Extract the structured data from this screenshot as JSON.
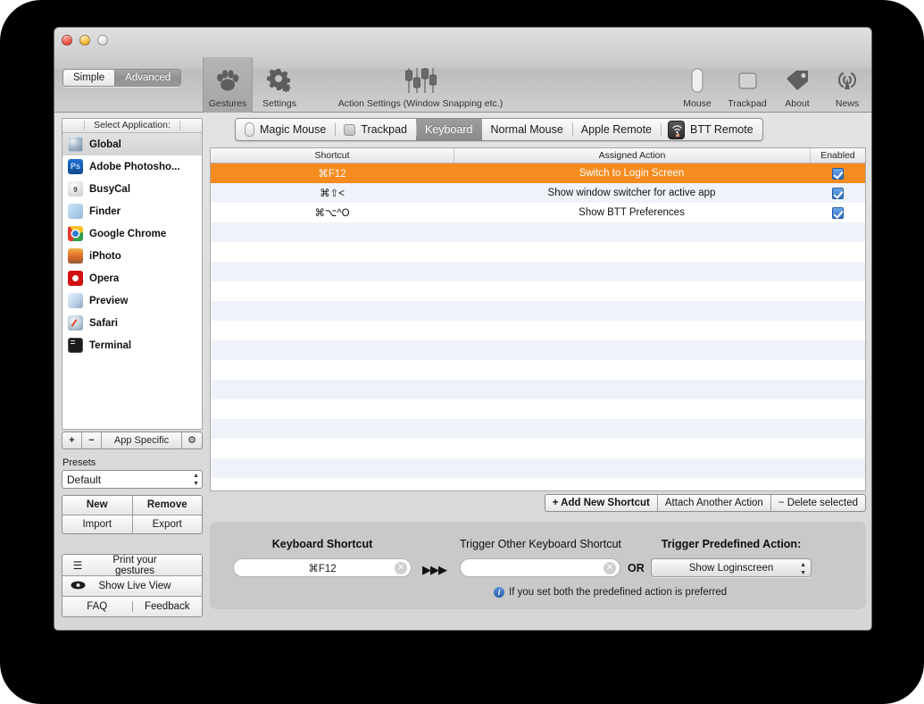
{
  "window": {
    "traffic_lights": [
      "close",
      "minimize",
      "zoom"
    ]
  },
  "toolbar": {
    "mode_simple": "Simple",
    "mode_advanced": "Advanced",
    "items": [
      {
        "label": "Gestures",
        "icon": "paw-icon",
        "selected": true
      },
      {
        "label": "Settings",
        "icon": "gear-icon",
        "selected": false
      },
      {
        "label": "Action Settings (Window Snapping etc.)",
        "icon": "sliders-icon",
        "selected": false
      },
      {
        "label": "Mouse",
        "icon": "mouse-icon",
        "selected": false
      },
      {
        "label": "Trackpad",
        "icon": "trackpad-icon",
        "selected": false
      },
      {
        "label": "About",
        "icon": "tag-icon",
        "selected": false
      },
      {
        "label": "News",
        "icon": "broadcast-icon",
        "selected": false
      }
    ]
  },
  "sidebar": {
    "list_header": "Select Application:",
    "apps": [
      {
        "name": "Global",
        "icon": "globe-icon",
        "selected": true
      },
      {
        "name": "Adobe Photosho...",
        "icon": "photoshop-icon",
        "selected": false
      },
      {
        "name": "BusyCal",
        "icon": "busycal-icon",
        "selected": false
      },
      {
        "name": "Finder",
        "icon": "finder-icon",
        "selected": false
      },
      {
        "name": "Google Chrome",
        "icon": "chrome-icon",
        "selected": false
      },
      {
        "name": "iPhoto",
        "icon": "iphoto-icon",
        "selected": false
      },
      {
        "name": "Opera",
        "icon": "opera-icon",
        "selected": false
      },
      {
        "name": "Preview",
        "icon": "preview-icon",
        "selected": false
      },
      {
        "name": "Safari",
        "icon": "safari-icon",
        "selected": false
      },
      {
        "name": "Terminal",
        "icon": "terminal-icon",
        "selected": false
      }
    ],
    "add_label": "+",
    "remove_label": "−",
    "app_specific_label": "App Specific",
    "gear_label": "⚙",
    "presets_label": "Presets",
    "presets_value": "Default",
    "buttons": {
      "new": "New",
      "remove": "Remove",
      "import": "Import",
      "export": "Export"
    },
    "footer": {
      "print_gestures": "Print your gestures",
      "show_live_view": "Show Live View",
      "faq": "FAQ",
      "feedback": "Feedback"
    }
  },
  "main": {
    "tabs": [
      {
        "label": "Magic Mouse",
        "icon": "mouse-glyph",
        "active": false
      },
      {
        "label": "Trackpad",
        "icon": "trackpad-glyph",
        "active": false
      },
      {
        "label": "Keyboard",
        "icon": "none",
        "active": true
      },
      {
        "label": "Normal Mouse",
        "icon": "none",
        "active": false
      },
      {
        "label": "Apple Remote",
        "icon": "none",
        "active": false
      },
      {
        "label": "BTT Remote",
        "icon": "btt-remote-glyph",
        "active": false
      }
    ],
    "table": {
      "columns": [
        "Shortcut",
        "Assigned Action",
        "Enabled"
      ],
      "rows": [
        {
          "shortcut": "⌘F12",
          "action": "Switch to Login Screen",
          "enabled": true,
          "selected": true
        },
        {
          "shortcut": "⌘⇧<",
          "action": "Show window switcher for active app",
          "enabled": true,
          "selected": false
        },
        {
          "shortcut": "⌘⌥^O",
          "action": "Show BTT Preferences",
          "enabled": true,
          "selected": false
        }
      ],
      "empty_row_count": 14
    },
    "table_actions": [
      {
        "label": "+ Add New Shortcut",
        "bold": true
      },
      {
        "label": "Attach Another Action",
        "bold": false
      },
      {
        "label": "− Delete selected",
        "bold": false
      }
    ],
    "detail": {
      "keyboard_shortcut_label": "Keyboard Shortcut",
      "keyboard_shortcut_value": "⌘F12",
      "arrows": "▶▶▶",
      "trigger_other_label": "Trigger Other Keyboard Shortcut",
      "trigger_other_value": "",
      "or_label": "OR",
      "predefined_label": "Trigger Predefined Action:",
      "predefined_value": "Show Loginscreen",
      "note": "If you set both the predefined action is preferred",
      "clear_glyph": "✕"
    }
  },
  "colors": {
    "selection_orange": "#f68b1f",
    "alt_row": "#eff3f9",
    "checkbox_blue": "#2f6fc4",
    "tab_active": "#8a8a8a"
  }
}
